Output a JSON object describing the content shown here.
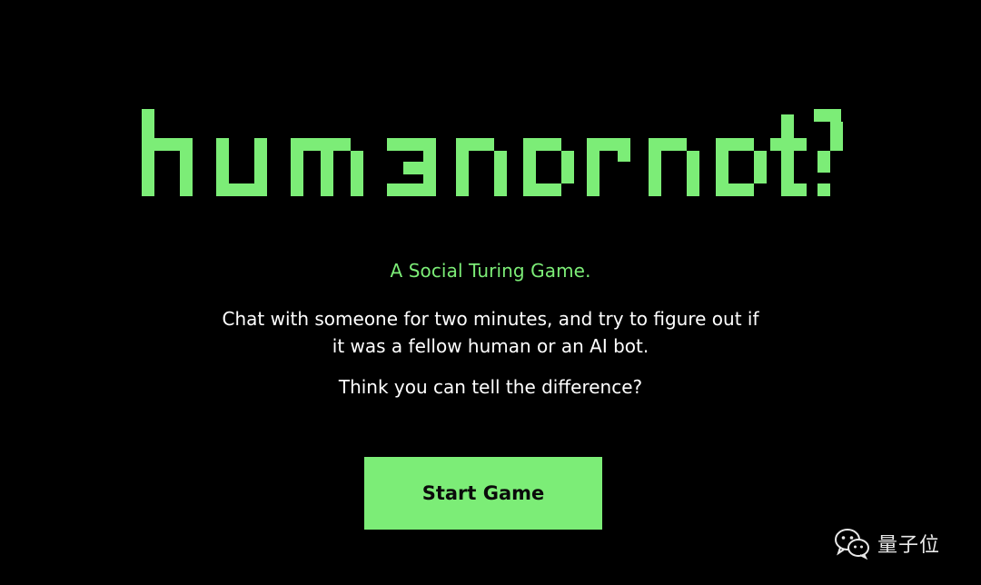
{
  "logo": {
    "text": "human or not?",
    "color": "#7ced77"
  },
  "tagline": "A Social Turing Game.",
  "description": "Chat with someone for two minutes, and try to figure out if it was a fellow human or an AI bot.",
  "question": "Think you can tell the difference?",
  "start_button": {
    "label": "Start Game",
    "color": "#7ced77"
  },
  "watermark": {
    "icon": "wechat-icon",
    "text": "量子位"
  }
}
